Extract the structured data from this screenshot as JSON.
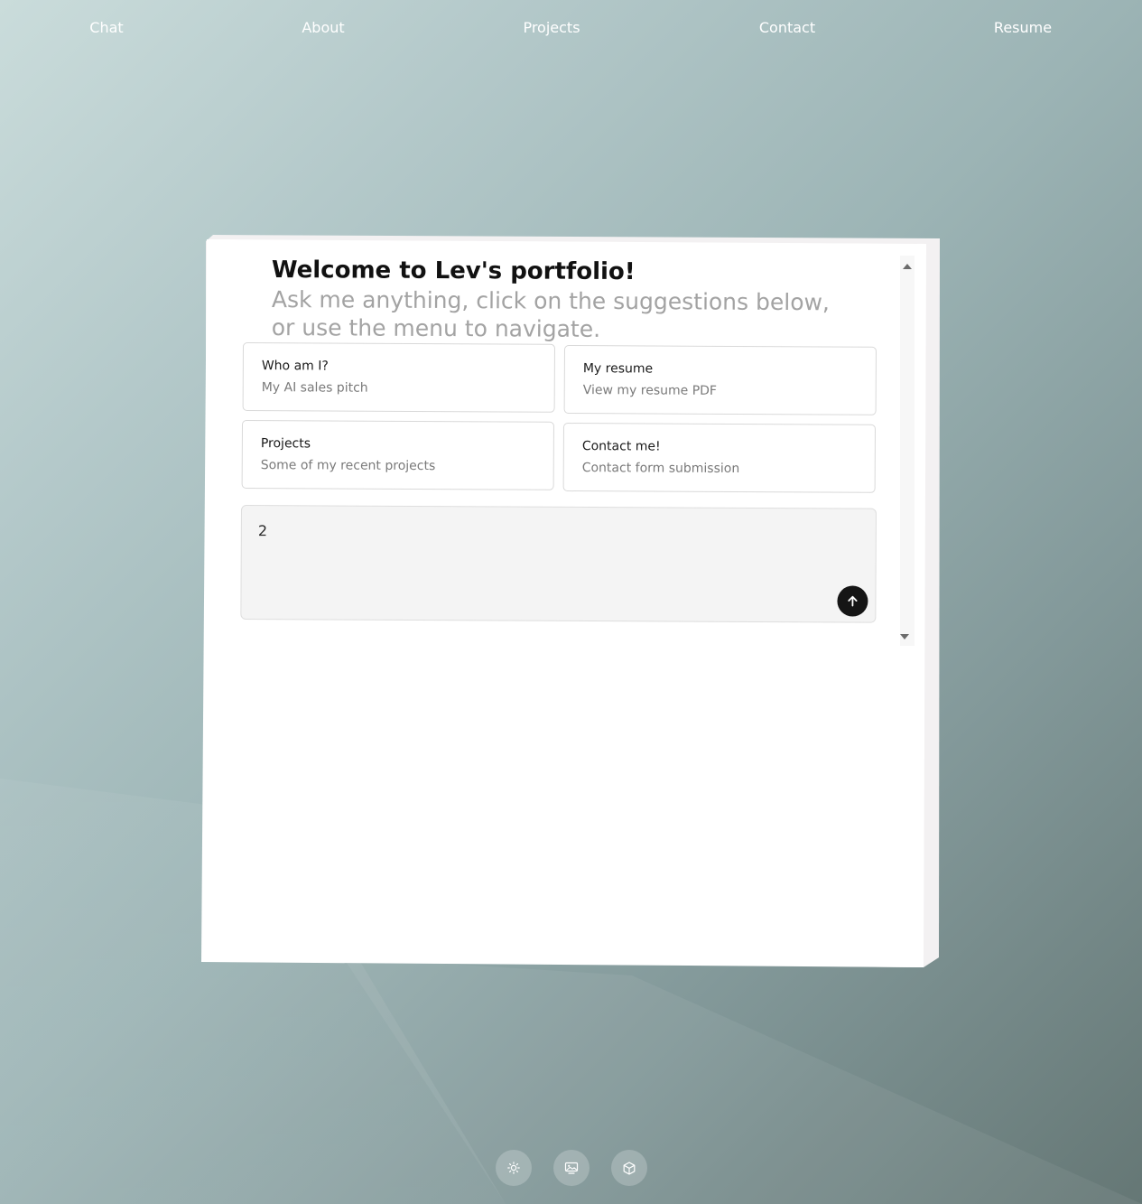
{
  "nav": {
    "items": [
      {
        "label": "Chat"
      },
      {
        "label": "About"
      },
      {
        "label": "Projects"
      },
      {
        "label": "Contact"
      },
      {
        "label": "Resume"
      }
    ]
  },
  "welcome": {
    "title": "Welcome to Lev's portfolio!",
    "subtitle": "Ask me anything, click on the suggestions below, or use the menu to navigate."
  },
  "suggestions": [
    {
      "title": "Who am I?",
      "subtitle": "My AI sales pitch"
    },
    {
      "title": "My resume",
      "subtitle": "View my resume PDF"
    },
    {
      "title": "Projects",
      "subtitle": "Some of my recent projects"
    },
    {
      "title": "Contact me!",
      "subtitle": "Contact form submission"
    }
  ],
  "chat": {
    "input_value": "2",
    "send_icon": "arrow-up-icon"
  },
  "controls": {
    "icons": [
      "sun-icon",
      "image-icon",
      "cube-icon"
    ]
  },
  "colors": {
    "accent": "#151515",
    "background_top": "#cadcdb",
    "background_bottom": "#657775"
  }
}
